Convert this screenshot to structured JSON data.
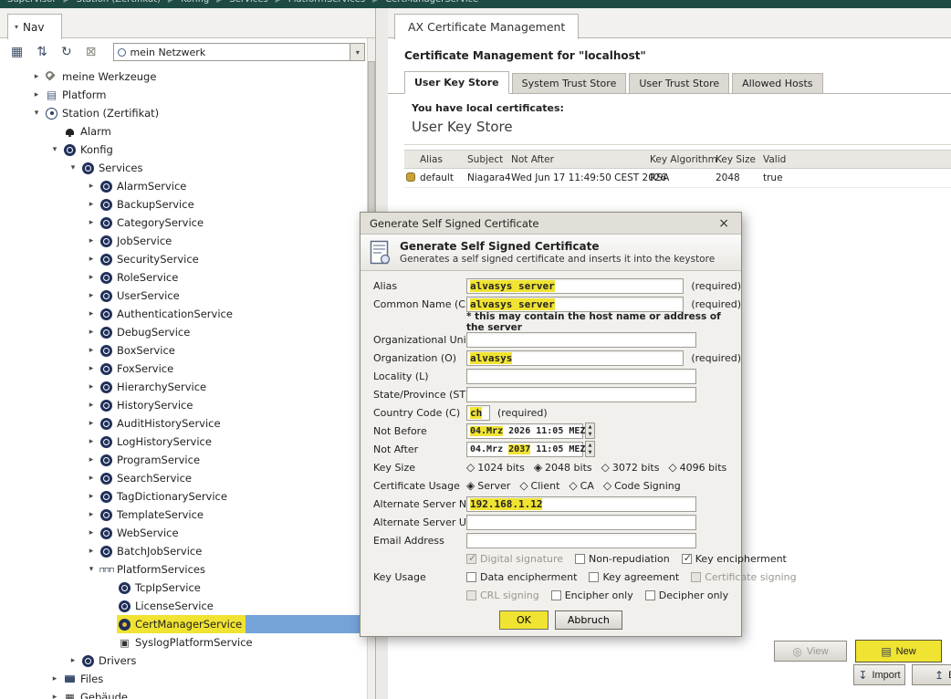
{
  "breadcrumb": {
    "items": [
      "Supervisor",
      "Station (Zertifikat)",
      "Konfig",
      "Services",
      "PlatformServices",
      "CertManagerService"
    ]
  },
  "nav": {
    "tab_label": "Nav",
    "toolbar_icons": [
      {
        "name": "grid-icon",
        "glyph": "▦"
      },
      {
        "name": "sort-icon",
        "glyph": "⇅"
      },
      {
        "name": "refresh-icon",
        "glyph": "↻"
      },
      {
        "name": "close-box-icon",
        "glyph": "⊠"
      }
    ],
    "combo_value": "mein Netzwerk",
    "tree": [
      {
        "label": "meine Werkzeuge",
        "level": 1,
        "state": "collapsed",
        "icon": "tools"
      },
      {
        "label": "Platform",
        "level": 1,
        "state": "collapsed",
        "icon": "platform"
      },
      {
        "label": "Station (Zertifikat)",
        "level": 1,
        "state": "expanded",
        "icon": "station"
      },
      {
        "label": "Alarm",
        "level": 2,
        "state": "leaf",
        "icon": "bell"
      },
      {
        "label": "Konfig",
        "level": 2,
        "state": "expanded",
        "icon": "config"
      },
      {
        "label": "Services",
        "level": 3,
        "state": "expanded",
        "icon": "services"
      },
      {
        "label": "AlarmService",
        "level": 4,
        "state": "collapsed",
        "icon": "circle"
      },
      {
        "label": "BackupService",
        "level": 4,
        "state": "collapsed",
        "icon": "circle"
      },
      {
        "label": "CategoryService",
        "level": 4,
        "state": "collapsed",
        "icon": "circle"
      },
      {
        "label": "JobService",
        "level": 4,
        "state": "collapsed",
        "icon": "circle"
      },
      {
        "label": "SecurityService",
        "level": 4,
        "state": "collapsed",
        "icon": "circle"
      },
      {
        "label": "RoleService",
        "level": 4,
        "state": "collapsed",
        "icon": "circle"
      },
      {
        "label": "UserService",
        "level": 4,
        "state": "collapsed",
        "icon": "circle"
      },
      {
        "label": "AuthenticationService",
        "level": 4,
        "state": "collapsed",
        "icon": "circle"
      },
      {
        "label": "DebugService",
        "level": 4,
        "state": "collapsed",
        "icon": "circle"
      },
      {
        "label": "BoxService",
        "level": 4,
        "state": "collapsed",
        "icon": "circle"
      },
      {
        "label": "FoxService",
        "level": 4,
        "state": "collapsed",
        "icon": "circle"
      },
      {
        "label": "HierarchyService",
        "level": 4,
        "state": "collapsed",
        "icon": "circle"
      },
      {
        "label": "HistoryService",
        "level": 4,
        "state": "collapsed",
        "icon": "circle"
      },
      {
        "label": "AuditHistoryService",
        "level": 4,
        "state": "collapsed",
        "icon": "circle"
      },
      {
        "label": "LogHistoryService",
        "level": 4,
        "state": "collapsed",
        "icon": "circle"
      },
      {
        "label": "ProgramService",
        "level": 4,
        "state": "collapsed",
        "icon": "circle"
      },
      {
        "label": "SearchService",
        "level": 4,
        "state": "collapsed",
        "icon": "circle"
      },
      {
        "label": "TagDictionaryService",
        "level": 4,
        "state": "collapsed",
        "icon": "circle"
      },
      {
        "label": "TemplateService",
        "level": 4,
        "state": "collapsed",
        "icon": "circle"
      },
      {
        "label": "WebService",
        "level": 4,
        "state": "collapsed",
        "icon": "circle"
      },
      {
        "label": "BatchJobService",
        "level": 4,
        "state": "collapsed",
        "icon": "circle"
      },
      {
        "label": "PlatformServices",
        "level": 4,
        "state": "expanded",
        "icon": "platform-services"
      },
      {
        "label": "TcpIpService",
        "level": 5,
        "state": "leaf",
        "icon": "circle"
      },
      {
        "label": "LicenseService",
        "level": 5,
        "state": "leaf",
        "icon": "circle"
      },
      {
        "label": "CertManagerService",
        "level": 5,
        "state": "leaf",
        "icon": "cert",
        "selected": true,
        "highlighted": true
      },
      {
        "label": "SyslogPlatformService",
        "level": 5,
        "state": "leaf",
        "icon": "monitor"
      },
      {
        "label": "Drivers",
        "level": 3,
        "state": "collapsed",
        "icon": "drivers"
      },
      {
        "label": "Files",
        "level": 2,
        "state": "collapsed",
        "icon": "folder"
      },
      {
        "label": "Gebäude",
        "level": 2,
        "state": "collapsed",
        "icon": "building"
      }
    ]
  },
  "main": {
    "view_tab": "AX Certificate Management",
    "heading": "Certificate Management for \"localhost\"",
    "store_tabs": [
      {
        "label": "User Key Store",
        "active": true
      },
      {
        "label": "System Trust Store",
        "active": false
      },
      {
        "label": "User Trust Store",
        "active": false
      },
      {
        "label": "Allowed Hosts",
        "active": false
      }
    ],
    "local_certs_note": "You have local certificates:",
    "section_title": "User Key Store",
    "table": {
      "columns": [
        "Alias",
        "Subject",
        "Not After",
        "Key Algorithm",
        "Key Size",
        "Valid"
      ],
      "rows": [
        {
          "alias": "default",
          "subject": "Niagara4",
          "not_after": "Wed Jun 17 11:49:50 CEST 2026",
          "key_algorithm": "RSA",
          "key_size": "2048",
          "valid": "true"
        }
      ]
    },
    "buttons": {
      "view": "View",
      "new": "New",
      "import": "Import",
      "export": "Ex"
    }
  },
  "dialog": {
    "title": "Generate Self Signed Certificate",
    "header_title": "Generate Self Signed Certificate",
    "header_subtitle": "Generates a self signed certificate and inserts it into the keystore",
    "required_label": "(required)",
    "note": "* this may contain the host name or address of the server",
    "fields": {
      "alias": {
        "label": "Alias",
        "value": "alvasys server",
        "highlight": true,
        "required": true
      },
      "common_name": {
        "label": "Common Name (CN)",
        "value": "alvasys server",
        "highlight": true,
        "required": true
      },
      "org_unit": {
        "label": "Organizational Unit (OU)",
        "value": ""
      },
      "organization": {
        "label": "Organization (O)",
        "value": "alvasys",
        "highlight": true,
        "required": true
      },
      "locality": {
        "label": "Locality (L)",
        "value": ""
      },
      "state": {
        "label": "State/Province (ST)",
        "value": ""
      },
      "country": {
        "label": "Country Code (C)",
        "value": "ch",
        "highlight": true,
        "required": true
      },
      "not_before": {
        "label": "Not Before",
        "segments": [
          {
            "text": "04.Mrz",
            "highlight": true
          },
          {
            "text": " 2026 11:05 MEZ",
            "highlight": false
          }
        ]
      },
      "not_after": {
        "label": "Not After",
        "segments": [
          {
            "text": "04.Mrz ",
            "highlight": false
          },
          {
            "text": "2037",
            "highlight": true
          },
          {
            "text": " 11:05 MEZ",
            "highlight": false
          }
        ]
      },
      "key_size": {
        "label": "Key Size",
        "options": [
          "1024 bits",
          "2048 bits",
          "3072 bits",
          "4096 bits"
        ],
        "selected": "2048 bits"
      },
      "cert_usage": {
        "label": "Certificate Usage",
        "options": [
          "Server",
          "Client",
          "CA",
          "Code Signing"
        ],
        "selected": "Server"
      },
      "alt_server_name": {
        "label": "Alternate Server Name",
        "value": "192.168.1.12",
        "highlight": true
      },
      "alt_server_uri": {
        "label": "Alternate Server URI",
        "value": ""
      },
      "email": {
        "label": "Email Address",
        "value": ""
      },
      "key_usage": {
        "label": "Key Usage",
        "rows": [
          [
            {
              "label": "Digital signature",
              "checked": true,
              "disabled": true
            },
            {
              "label": "Non-repudiation",
              "checked": false,
              "disabled": false
            },
            {
              "label": "Key encipherment",
              "checked": true,
              "disabled": false
            }
          ],
          [
            {
              "label": "Data encipherment",
              "checked": false,
              "disabled": false
            },
            {
              "label": "Key agreement",
              "checked": false,
              "disabled": false
            },
            {
              "label": "Certificate signing",
              "checked": false,
              "disabled": true
            }
          ],
          [
            {
              "label": "CRL signing",
              "checked": false,
              "disabled": true
            },
            {
              "label": "Encipher only",
              "checked": false,
              "disabled": false
            },
            {
              "label": "Decipher only",
              "checked": false,
              "disabled": false
            }
          ]
        ]
      },
      "ok": "OK",
      "cancel": "Abbruch"
    }
  }
}
